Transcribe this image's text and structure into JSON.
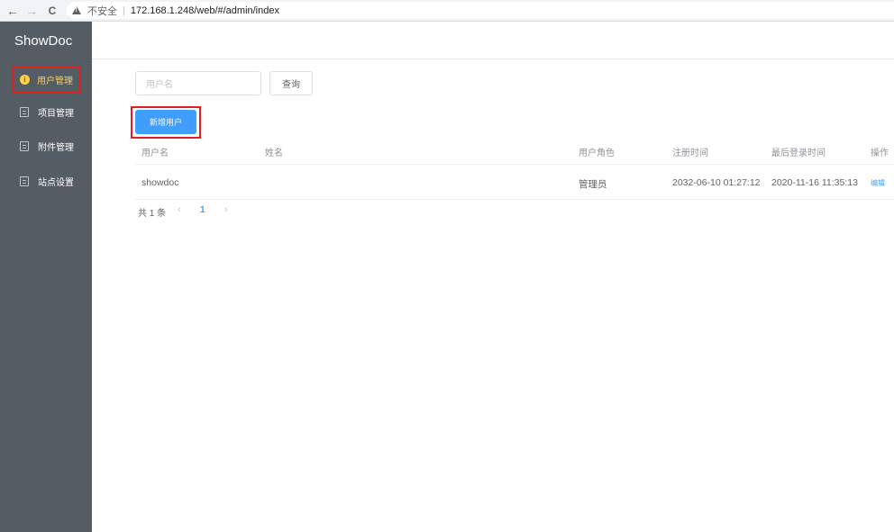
{
  "browser": {
    "back": "←",
    "forward": "→",
    "reload": "C",
    "insecure_label": "不安全",
    "url": "172.168.1.248/web/#/admin/index"
  },
  "sidebar": {
    "brand": "ShowDoc",
    "items": [
      {
        "label": "用户管理",
        "active": true
      },
      {
        "label": "项目管理",
        "active": false
      },
      {
        "label": "附件管理",
        "active": false
      },
      {
        "label": "站点设置",
        "active": false
      }
    ]
  },
  "search": {
    "placeholder": "用户名",
    "button_label": "查询"
  },
  "add_user_label": "新增用户",
  "table": {
    "columns": [
      "用户名",
      "姓名",
      "用户角色",
      "注册时间",
      "最后登录时间",
      "操作"
    ],
    "rows": [
      {
        "username": "showdoc",
        "name": "",
        "role": "管理员",
        "registered": "2032-06-10 01:27:12",
        "last_login": "2020-11-16 11:35:13",
        "action": "编辑"
      }
    ]
  },
  "pagination": {
    "total": "共 1 条",
    "prev": "‹",
    "current": "1",
    "next": "›"
  },
  "colors": {
    "sidebar_bg": "#545c64",
    "active_text": "#ffd04b",
    "primary": "#409eff",
    "highlight_box": "#e02020"
  }
}
